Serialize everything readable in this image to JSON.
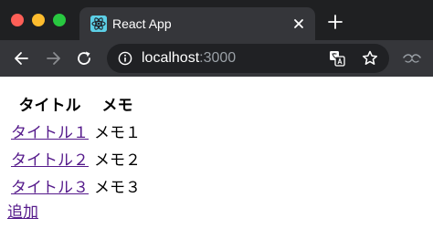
{
  "browser": {
    "tab": {
      "title": "React App",
      "favicon": "react-icon"
    },
    "address_bar": {
      "host": "localhost",
      "port": ":3000"
    },
    "icons": [
      "back-icon",
      "forward-icon",
      "reload-icon",
      "info-icon",
      "translate-icon",
      "star-icon",
      "profile-icon",
      "close-icon",
      "plus-icon"
    ],
    "colors": {
      "titlebar": "#1f2022",
      "tab_active": "#35363a",
      "toolbar": "#35363a",
      "omnibox": "#202124",
      "traffic_red": "#fe5f57",
      "traffic_yellow": "#febc2e",
      "traffic_green": "#28c840",
      "link_visited": "#551a8b"
    }
  },
  "page": {
    "table": {
      "headers": [
        "タイトル",
        "メモ"
      ],
      "rows": [
        {
          "title": "タイトル１",
          "memo": "メモ１"
        },
        {
          "title": "タイトル２",
          "memo": "メモ２"
        },
        {
          "title": "タイトル３",
          "memo": "メモ３"
        }
      ]
    },
    "add_link": "追加"
  }
}
